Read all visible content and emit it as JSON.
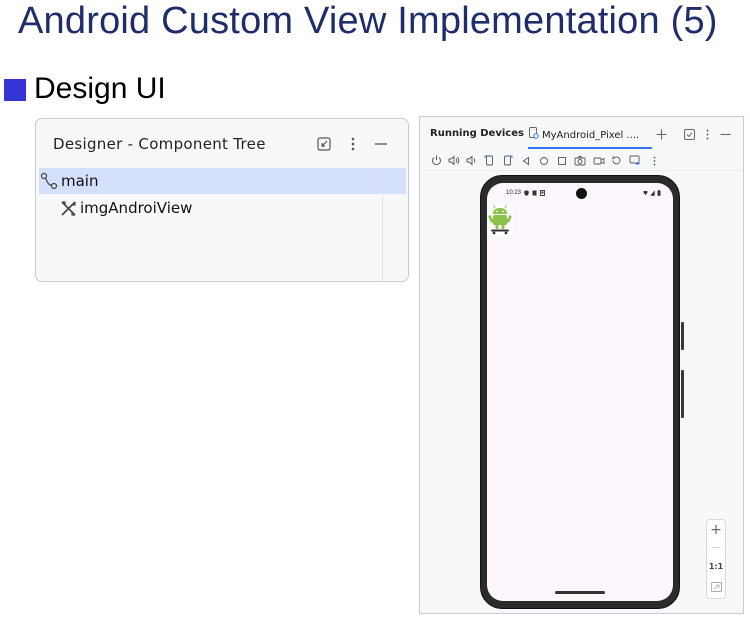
{
  "slide": {
    "title": "Android Custom View Implementation (5)",
    "bullet": "Design UI",
    "bullet_color": "#3535d6",
    "title_color": "#1f2d6b"
  },
  "component_tree": {
    "title": "Designer - Component Tree",
    "header_icons": [
      "collapse-icon",
      "more-vert-icon",
      "minimize-icon"
    ],
    "items": [
      {
        "label": "main",
        "icon": "layout-connector-icon",
        "selected": true
      },
      {
        "label": "imgAndroiView",
        "icon": "image-view-icon",
        "selected": false
      }
    ],
    "selection_color": "#d5e1fb"
  },
  "running_devices": {
    "title": "Running Devices",
    "tab_label": "MyAndroid_Pixel ....",
    "tab_icon": "device-icon",
    "tab_actions": [
      "add-icon",
      "layout-icon",
      "more-vert-icon",
      "minimize-icon"
    ],
    "toolbar_icons": [
      "power-icon",
      "volume-up-icon",
      "volume-down-icon",
      "rotate-left-icon",
      "rotate-right-icon",
      "back-icon",
      "home-icon",
      "overview-icon",
      "screenshot-icon",
      "record-icon",
      "reset-icon",
      "snapshot-icon",
      "more-vert-icon"
    ],
    "phone": {
      "status_time": "10:23",
      "status_icons": [
        "shield-icon",
        "sim-icon",
        "notification-icon",
        "wifi-icon",
        "signal-icon",
        "battery-icon"
      ],
      "content_image": "android-skateboard-image",
      "screen_color": "#fdf7fd"
    },
    "zoom": {
      "plus": "+",
      "minus": "—",
      "actual": "1:1",
      "fit_icon": "fit-screen-icon"
    },
    "accent_color": "#3574f0"
  }
}
